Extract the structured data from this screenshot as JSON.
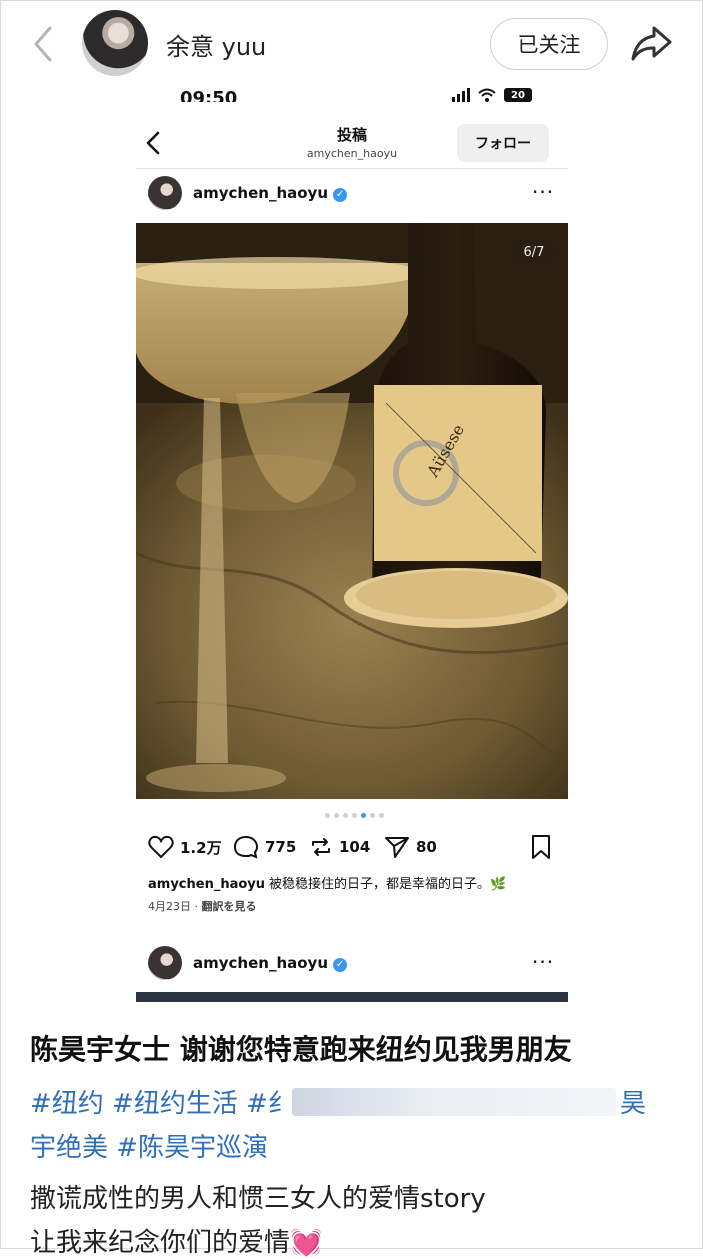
{
  "header": {
    "username": "余意 yuu",
    "follow_label": "已关注"
  },
  "embedded": {
    "status_time": "09:50",
    "battery": "20",
    "title": "投稿",
    "subtitle": "amychen_haoyu",
    "follow_label": "フォロー",
    "post_user": "amychen_haoyu",
    "photo_counter": "6/7",
    "likes": "1.2万",
    "comments": "775",
    "reposts": "104",
    "shares": "80",
    "caption_user": "amychen_haoyu",
    "caption_text": "被稳稳接住的日子，都是幸福的日子。🌿",
    "date": "4月23日",
    "translate": "翻訳を見る",
    "next_post_user": "amychen_haoyu",
    "carousel_count": 7,
    "carousel_active": 5
  },
  "post": {
    "headline": "陈昊宇女士 谢谢您特意跑来纽约见我男朋友",
    "tags_line1_start": "#纽约 #纽约生活 #纟",
    "tags_line1_end": "昊",
    "tags_line2": "宇绝美 #陈昊宇巡演",
    "body_line1": "撒谎成性的男人和惯三女人的爱情story",
    "body_line2": "让我来纪念你们的爱情💓"
  },
  "colors": {
    "link": "#2f6fba",
    "verified": "#3897f0"
  }
}
